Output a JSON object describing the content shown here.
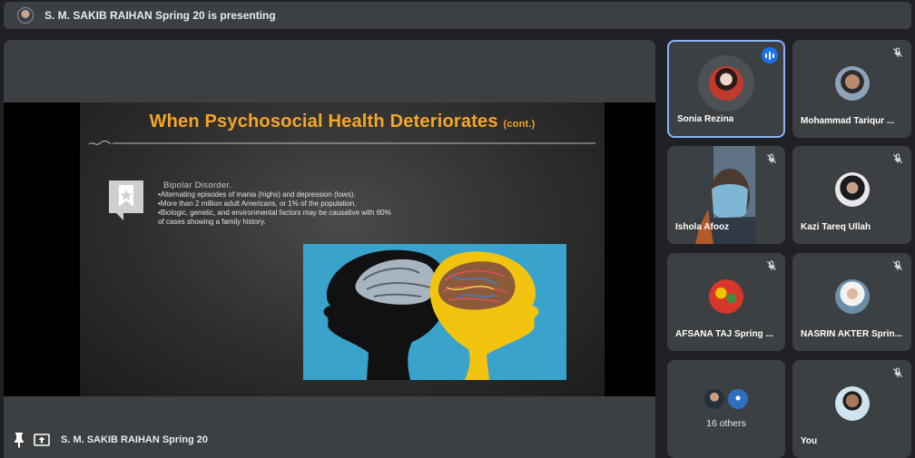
{
  "banner": {
    "text": "S. M. SAKIB RAIHAN Spring 20 is presenting"
  },
  "slide": {
    "title": "When Psychosocial Health Deteriorates",
    "title_suffix": "(cont.)",
    "heading": "Bipolar Disorder.",
    "bullets": [
      "•Alternating episodes of mania (highs) and depression (lows).",
      "•More than 2 million adult Americans, or 1% of the population.",
      "•Biologic, genetic, and environmental factors may be causative with 60%",
      "of cases showing a family history."
    ],
    "accent_color": "#f5a623"
  },
  "presenter_bar": {
    "name": "S. M. SAKIB RAIHAN Spring 20"
  },
  "participants": [
    {
      "name": "Sonia Rezina",
      "speaking": true
    },
    {
      "name": "Mohammad Tariqur ...",
      "muted": true
    },
    {
      "name": "Ishola Afooz",
      "muted": true,
      "video": true
    },
    {
      "name": "Kazi Tareq Ullah",
      "muted": true
    },
    {
      "name": "AFSANA TAJ Spring ...",
      "muted": true
    },
    {
      "name": "NASRIN AKTER Sprin...",
      "muted": true
    },
    {
      "name": "16 others",
      "group": true
    },
    {
      "name": "You",
      "muted": true
    }
  ],
  "colors": {
    "background": "#202124",
    "tile": "#3c4043",
    "active_border": "#8ab4f8",
    "speaking": "#1a73e8"
  }
}
